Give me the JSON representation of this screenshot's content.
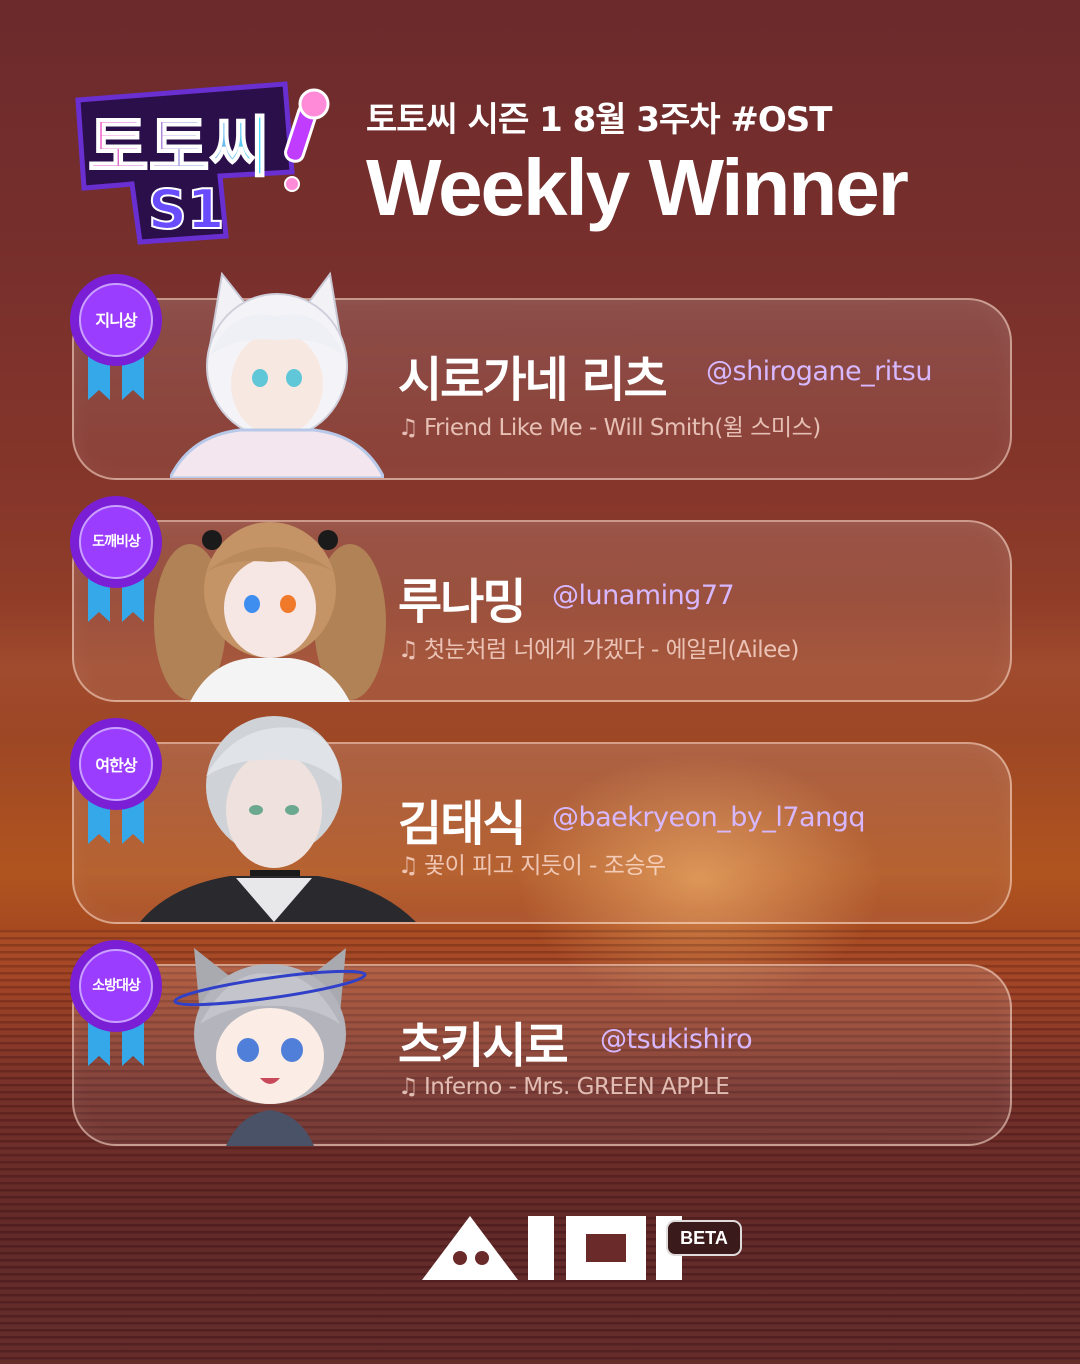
{
  "season_logo": {
    "text_line1": "토토씨",
    "text_line2": "S1"
  },
  "header": {
    "subtitle": "토토씨 시즌 1 8월 3주차  #OST",
    "title": "Weekly Winner"
  },
  "winners": [
    {
      "award": "지니상",
      "name": "시로가네 리츠",
      "handle": "@shirogane_ritsu",
      "song": "Friend Like Me -  Will Smith(윌 스미스)"
    },
    {
      "award": "도깨비상",
      "name": "루나밍",
      "handle": "@lunaming77",
      "song": "첫눈처럼 너에게 가겠다 - 에일리(Ailee)"
    },
    {
      "award": "여한상",
      "name": "김태식",
      "handle": "@baekryeon_by_l7angq",
      "song": "꽃이 피고 지듯이 - 조승우"
    },
    {
      "award": "소방대상",
      "name": "츠키시로",
      "handle": "@tsukishiro",
      "song": "Inferno - Mrs. GREEN APPLE"
    }
  ],
  "brand": {
    "beta_label": "BETA"
  },
  "colors": {
    "accent_purple": "#7a1fd6",
    "ribbon_blue": "#34a8e8",
    "handle_lavender": "#d7b8ff",
    "logo_pink": "#ff4fc0",
    "logo_cyan": "#3fe0ff"
  }
}
